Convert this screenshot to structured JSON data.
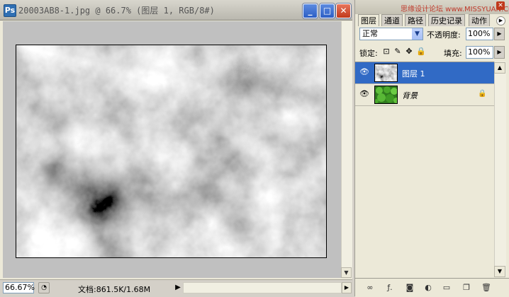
{
  "document": {
    "title": "20003AB8-1.jpg @ 66.7% (图层 1, RGB/8#)",
    "title_icon": "Ps",
    "zoom": "66.67%",
    "doc_info": "文档:861.5K/1.68M"
  },
  "window_buttons": {
    "minimize": "minimize-icon",
    "maximize": "maximize-icon",
    "close": "close-icon"
  },
  "panel": {
    "watermark": "思缘设计论坛 www.MISSYUAN.COM",
    "tabs": [
      "图层",
      "通道",
      "路径",
      "历史记录",
      "动作"
    ],
    "blend_mode": "正常",
    "opacity_label": "不透明度:",
    "opacity_value": "100%",
    "lock_label": "锁定:",
    "fill_label": "填充:",
    "fill_value": "100%",
    "layers": [
      {
        "name": "图层 1",
        "selected": true,
        "locked": false
      },
      {
        "name": "背景",
        "selected": false,
        "locked": true
      }
    ],
    "bottom_icons": [
      "link-icon",
      "layer-style-icon",
      "mask-icon",
      "adjustment-icon",
      "group-icon",
      "new-layer-icon",
      "trash-icon"
    ]
  },
  "colors": {
    "selection": "#316ac5",
    "canvas_bg": "#c0c0c0",
    "close_red": "#c0391b"
  }
}
